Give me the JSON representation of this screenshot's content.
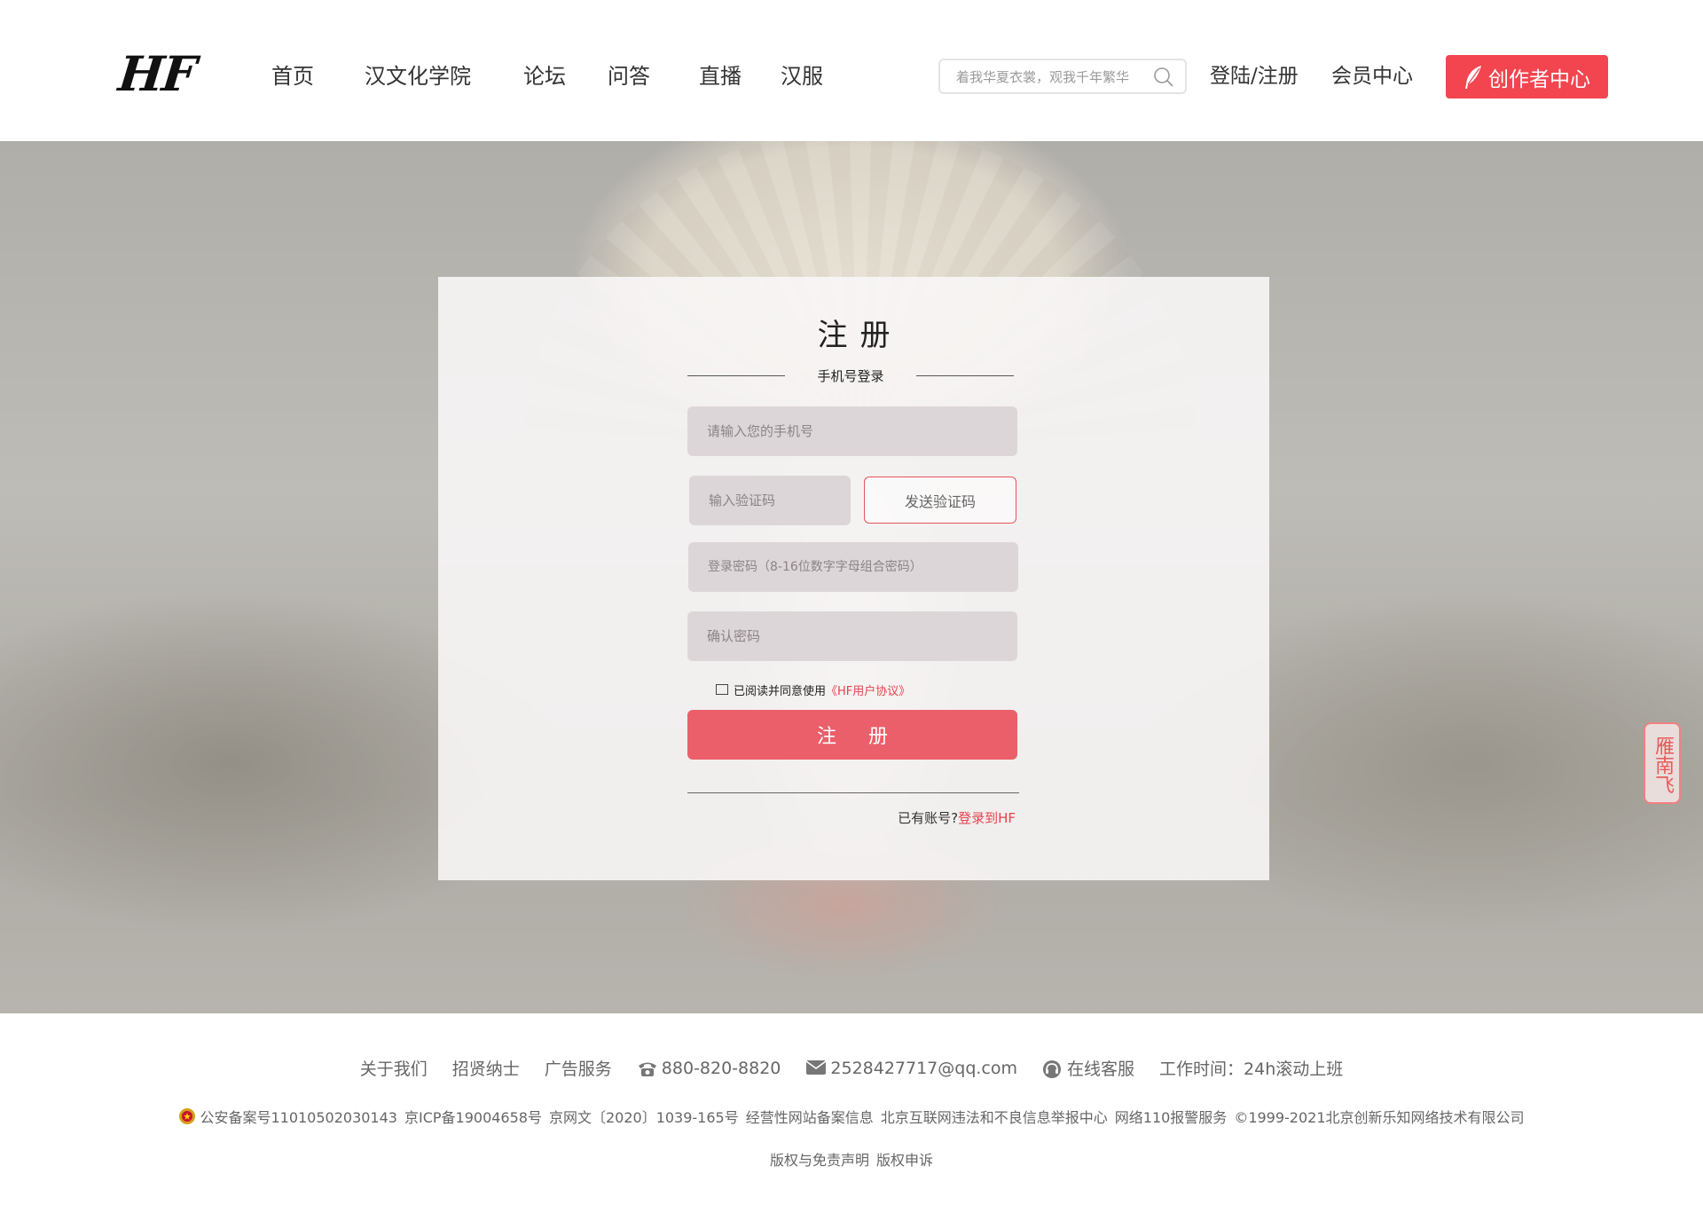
{
  "header": {
    "logo_text": "HF",
    "nav": [
      "首页",
      "汉文化学院",
      "论坛",
      "问答",
      "直播",
      "汉服"
    ],
    "search_placeholder": "着我华夏衣裳，观我千年繁华",
    "login_register": "登陆/注册",
    "member_center": "会员中心",
    "creator_center": "创作者中心"
  },
  "hero": {
    "seal_text": "雁南飞"
  },
  "register": {
    "title": "注册",
    "subtitle": "手机号登录",
    "phone_placeholder": "请输入您的手机号",
    "code_placeholder": "输入验证码",
    "send_code": "发送验证码",
    "password_placeholder": "登录密码（8-16位数字字母组合密码）",
    "confirm_placeholder": "确认密码",
    "agree_text": "已阅读并同意使用",
    "agree_link": "《HF用户协议》",
    "submit": "注册",
    "have_account": "已有账号?",
    "login_link": "登录到HF"
  },
  "footer": {
    "about": "关于我们",
    "recruit": "招贤纳士",
    "ads": "广告服务",
    "phone": "880-820-8820",
    "email": "2528427717@qq.com",
    "online_service": "在线客服",
    "hours": "工作时间：24h滚动上班",
    "beian": "公安备案号11010502030143",
    "icp": "京ICP备19004658号",
    "wangwen": "京网文〔2020〕1039-165号",
    "business_info": "经营性网站备案信息",
    "report_center": "北京互联网违法和不良信息举报中心",
    "police": "网络110报警服务",
    "copyright": "©1999-2021北京创新乐知网络技术有限公司",
    "rights": "版权与免责声明",
    "appeal": "版权申诉"
  },
  "colors": {
    "accent": "#f2454f",
    "submit": "#eb5f6a",
    "link": "#e8414c",
    "field_bg": "#ddd6d8"
  }
}
